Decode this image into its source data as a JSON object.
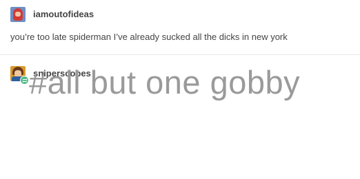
{
  "posts": [
    {
      "username": "iamoutofideas",
      "text": "you’re too late spiderman I’ve already sucked all the dicks in new york"
    },
    {
      "username": "sniperscopes",
      "tag": "#all but one gobby"
    }
  ],
  "icons": {
    "avatar_1": "avatar",
    "avatar_2": "avatar",
    "reblog": "reblog-icon"
  },
  "colors": {
    "reblog_badge": "#56bc8a",
    "text": "#444444",
    "tag": "#9a9a9a",
    "divider": "#e7e7e7"
  }
}
